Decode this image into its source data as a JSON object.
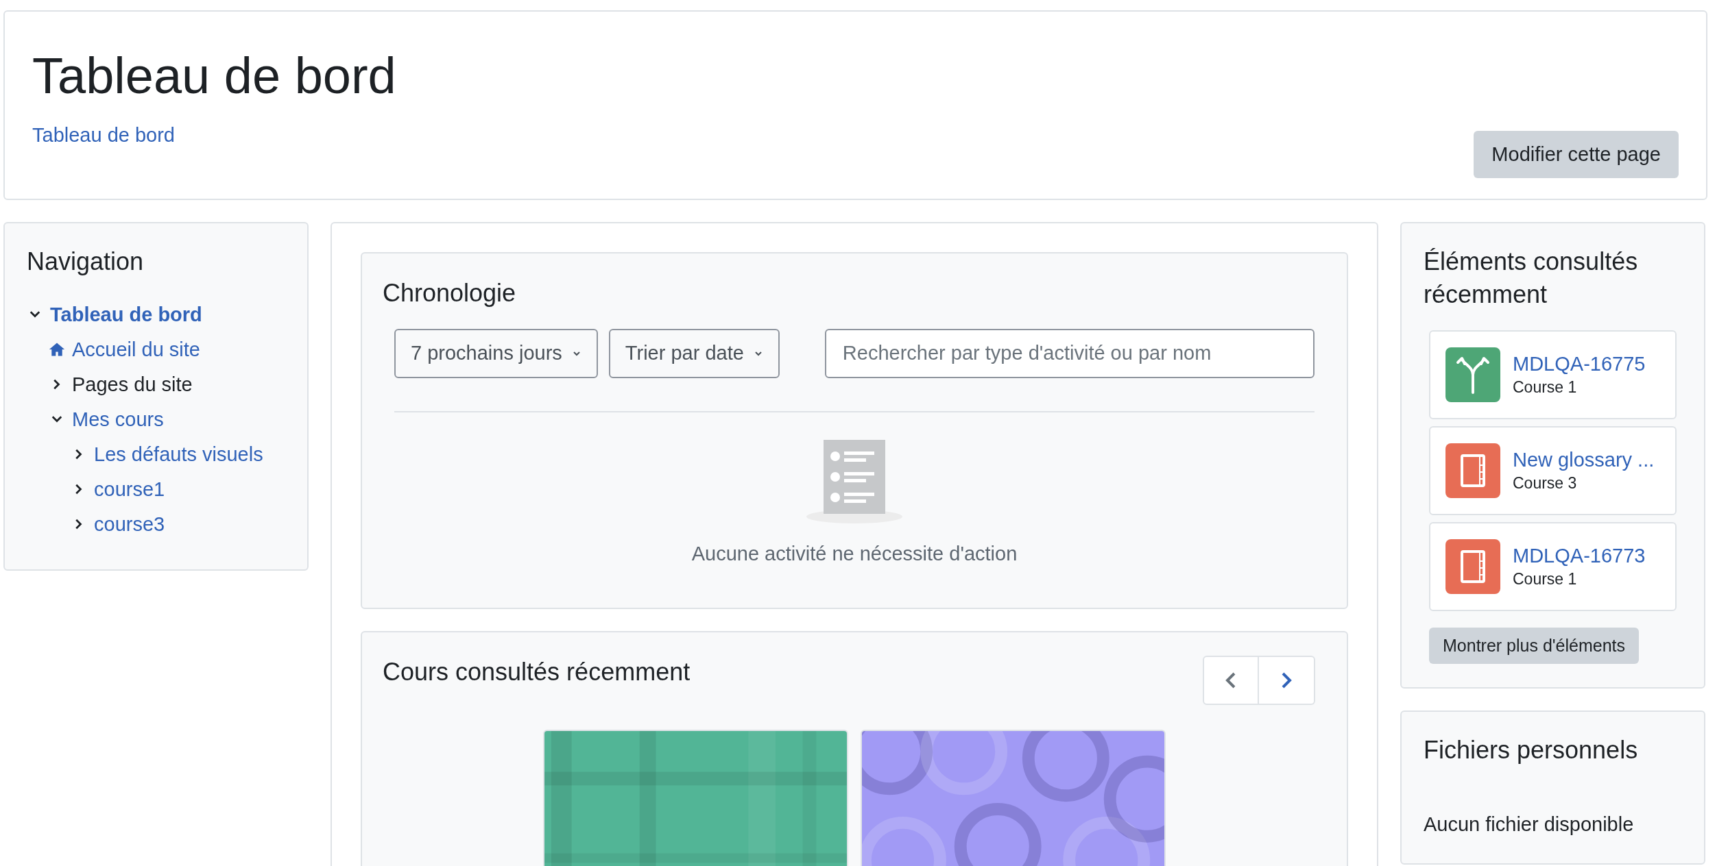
{
  "header": {
    "title": "Tableau de bord",
    "breadcrumb": [
      {
        "label": "Tableau de bord"
      }
    ],
    "button": "Modifier cette page"
  },
  "navigation": {
    "title": "Navigation",
    "items": [
      {
        "label": "Tableau de bord",
        "kind": "branch",
        "link": true,
        "current": true,
        "expanded": true,
        "children": [
          {
            "label": "Accueil du site",
            "kind": "home",
            "link": true,
            "current": false,
            "expanded": false
          },
          {
            "label": "Pages du site",
            "kind": "branch",
            "link": false,
            "current": false,
            "expanded": false
          },
          {
            "label": "Mes cours",
            "kind": "branch",
            "link": true,
            "current": false,
            "expanded": true,
            "children": [
              {
                "label": "Les défauts visuels",
                "kind": "branch",
                "link": true,
                "current": false,
                "expanded": false
              },
              {
                "label": "course1",
                "kind": "branch",
                "link": true,
                "current": false,
                "expanded": false
              },
              {
                "label": "course3",
                "kind": "branch",
                "link": true,
                "current": false,
                "expanded": false
              }
            ]
          }
        ]
      }
    ]
  },
  "timeline": {
    "title": "Chronologie",
    "filters": [
      {
        "label": "7 prochains jours"
      },
      {
        "label": "Trier par date"
      }
    ],
    "search": {
      "placeholder": "Rechercher par type d'activité ou par nom"
    },
    "empty_message": "Aucune activité ne nécessite d'action"
  },
  "recent_courses": {
    "title": "Cours consultés récemment",
    "pager": [
      {
        "kind": "prev",
        "disabled": true
      },
      {
        "kind": "next",
        "disabled": false
      }
    ],
    "courses": [
      {
        "color": "#52b596"
      },
      {
        "color": "#a19af5"
      }
    ]
  },
  "recent_items": {
    "title": "Éléments consultés récemment",
    "items": [
      {
        "title": "MDLQA-16775",
        "course": "Course 1",
        "kind": "forum",
        "color": "#4ea676"
      },
      {
        "title": "New glossary ...",
        "course": "Course 3",
        "kind": "book",
        "color": "#e76d55"
      },
      {
        "title": "MDLQA-16773",
        "course": "Course 1",
        "kind": "book",
        "color": "#e76d55"
      }
    ],
    "button": "Montrer plus d'éléments"
  },
  "private_files": {
    "title": "Fichiers personnels",
    "message": "Aucun fichier disponible"
  }
}
